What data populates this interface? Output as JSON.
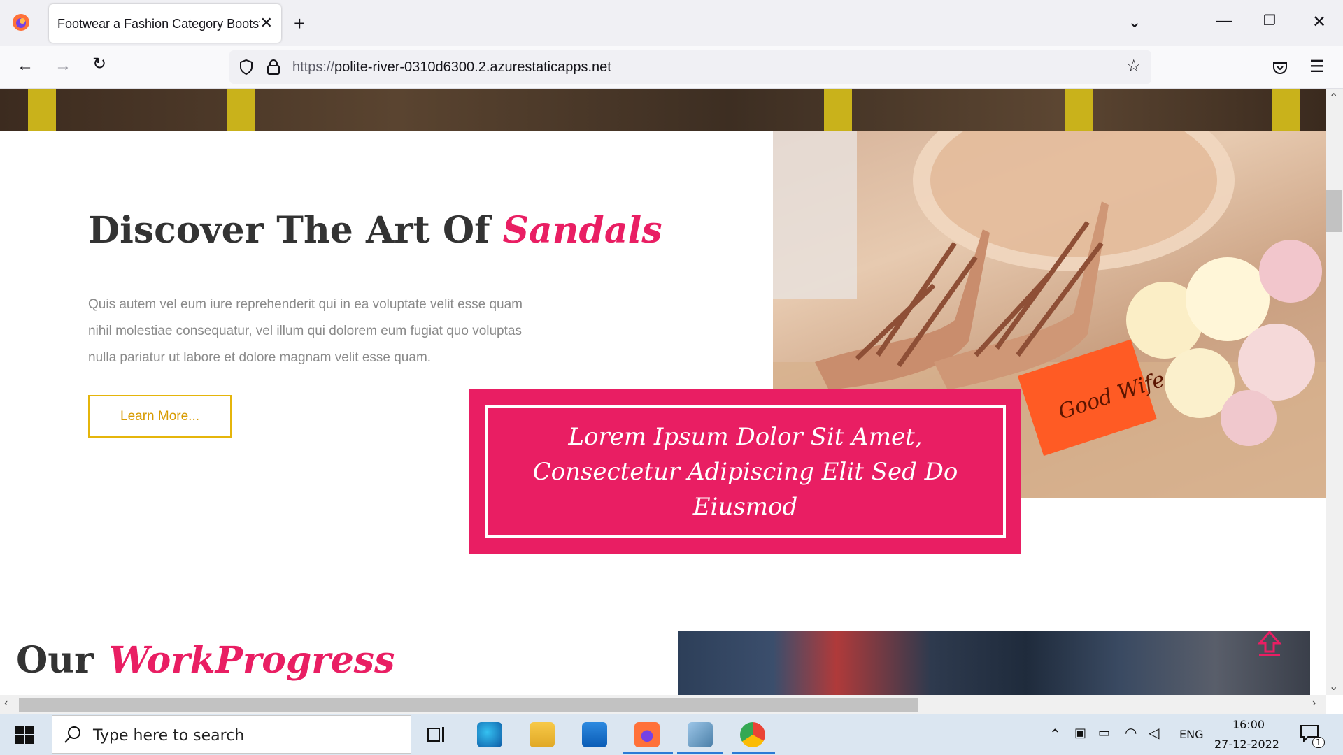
{
  "browser": {
    "tab_title": "Footwear a Fashion Category Bootstrap",
    "url_scheme": "https://",
    "url_host": "polite-river-0310d6300.2.azurestaticapps.net"
  },
  "section": {
    "title": "Discover The Art Of",
    "title_accent": "Sandals",
    "paragraph": "Quis autem vel eum iure reprehenderit qui in ea voluptate velit esse quam nihil molestiae consequatur, vel illum qui dolorem eum fugiat quo voluptas nulla pariatur ut labore et dolore magnam velit esse quam.",
    "button_label": "Learn More...",
    "quote": "Lorem Ipsum Dolor Sit Amet, Consectetur Adipiscing Elit Sed Do Eiusmod",
    "book_text": "Good Wife"
  },
  "work": {
    "title": "Our",
    "title_accent": "WorkProgress"
  },
  "colors": {
    "accent": "#e91e63",
    "button_border": "#e5b50b",
    "taskbar": "#dbe6f1"
  },
  "taskbar": {
    "search_placeholder": "Type here to search",
    "language": "ENG",
    "time": "16:00",
    "date": "27-12-2022",
    "notification_count": "1"
  }
}
